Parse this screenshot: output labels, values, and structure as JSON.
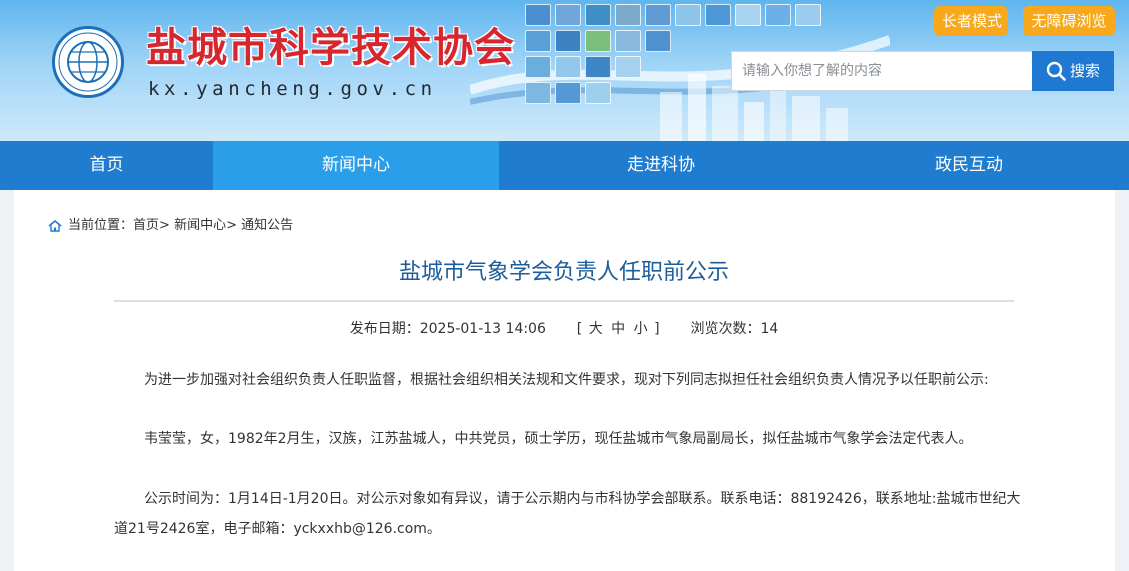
{
  "header": {
    "site_title": "盐城市科学技术协会",
    "site_domain": "kx.yancheng.gov.cn",
    "elder_mode": "长者模式",
    "accessible_mode": "无障碍浏览",
    "search_placeholder": "请输入你想了解的内容",
    "search_button": "搜索"
  },
  "nav": {
    "items": [
      {
        "label": "首页"
      },
      {
        "label": "新闻中心",
        "active": true
      },
      {
        "label": "走进科协"
      },
      {
        "label": "政民互动"
      }
    ]
  },
  "breadcrumb": {
    "prefix": "当前位置：",
    "items": [
      "首页",
      "新闻中心",
      "通知公告"
    ],
    "separator": ">"
  },
  "article": {
    "title": "盐城市气象学会负责人任职前公示",
    "publish_label": "发布日期：",
    "publish_date": "2025-01-13 14:06",
    "size_open": "[",
    "size_large": "大",
    "size_medium": "中",
    "size_small": "小",
    "size_close": "]",
    "views_label": "浏览次数：",
    "views": "14",
    "paragraphs": [
      "为进一步加强对社会组织负责人任职监督，根据社会组织相关法规和文件要求，现对下列同志拟担任社会组织负责人情况予以任职前公示:",
      "韦莹莹，女，1982年2月生，汉族，江苏盐城人，中共党员，硕士学历，现任盐城市气象局副局长，拟任盐城市气象学会法定代表人。",
      "公示时间为：1月14日-1月20日。对公示对象如有异议，请于公示期内与市科协学会部联系。联系电话：88192426，联系地址:盐城市世纪大道21号2426室，电子邮箱：yckxxhb@126.com。"
    ]
  },
  "colors": {
    "title_red": "#d8262f",
    "nav_blue": "#1f7ccf",
    "nav_active": "#2a9ee8",
    "mode_orange": "#f7a81b",
    "article_title": "#1d5d9b"
  }
}
